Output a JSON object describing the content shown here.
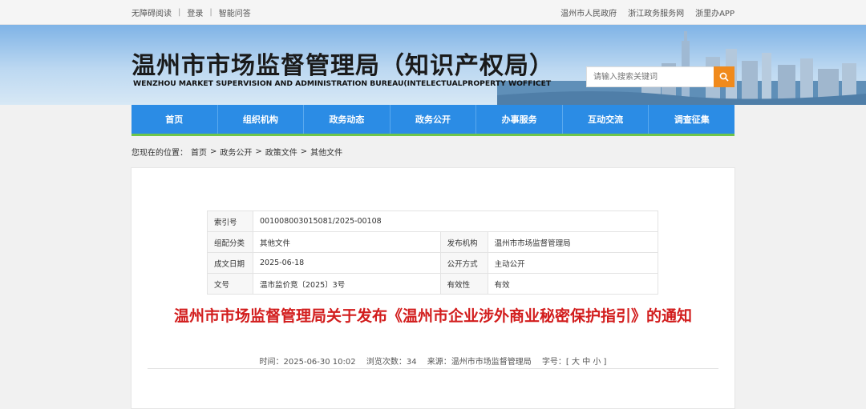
{
  "topbar": {
    "left": [
      "无障碍阅读",
      "登录",
      "智能问答"
    ],
    "right": [
      "温州市人民政府",
      "浙江政务服务网",
      "浙里办APP"
    ]
  },
  "banner": {
    "title": "温州市市场监督管理局（知识产权局）",
    "subtitle": "WENZHOU MARKET SUPERVISION AND ADMINISTRATION BUREAU(INTELECTUALPROPERTY WOFFICET",
    "search_placeholder": "请输入搜索关键词"
  },
  "nav": [
    "首页",
    "组织机构",
    "政务动态",
    "政务公开",
    "办事服务",
    "互动交流",
    "调查征集"
  ],
  "breadcrumb": {
    "prefix": "您现在的位置：",
    "items": [
      "首页",
      ">",
      "政务公开",
      ">",
      "政策文件",
      ">",
      "其他文件"
    ]
  },
  "meta": {
    "index_label": "索引号",
    "index_value": "001008003015081/2025-00108",
    "category_label": "组配分类",
    "category_value": "其他文件",
    "publisher_label": "发布机构",
    "publisher_value": "温州市市场监督管理局",
    "date_label": "成文日期",
    "date_value": "2025-06-18",
    "open_label": "公开方式",
    "open_value": "主动公开",
    "docno_label": "文号",
    "docno_value": "温市监价竞〔2025〕3号",
    "validity_label": "有效性",
    "validity_value": "有效"
  },
  "document": {
    "title": "温州市市场监督管理局关于发布《温州市企业涉外商业秘密保护指引》的通知",
    "time": "时间：2025-06-30 10:02",
    "views_label": "浏览次数：",
    "views": "34",
    "source": "来源：温州市市场监督管理局",
    "fontsize": "字号：[ 大 中 小 ]"
  },
  "colors": {
    "nav": "#2b8ce5",
    "nav_underline": "#6ec54a",
    "title_red": "#d21d1d",
    "search_btn": "#f08a1c"
  }
}
